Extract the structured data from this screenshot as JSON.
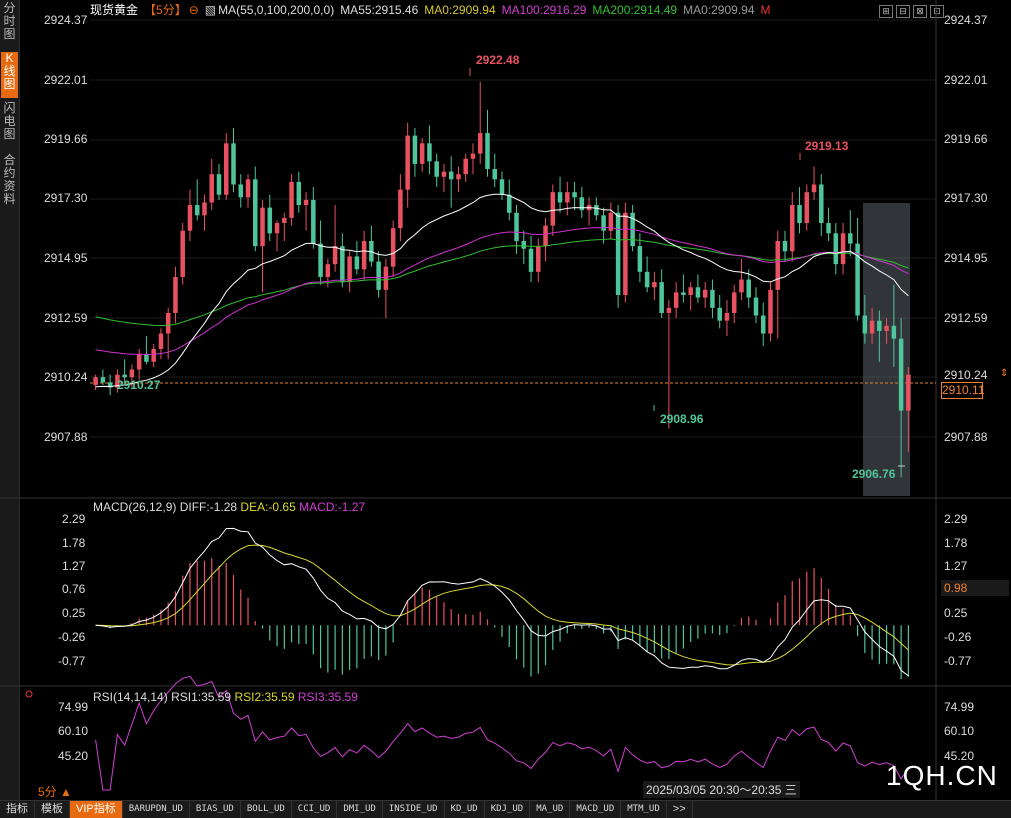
{
  "sidebar": [
    {
      "label": "分时图",
      "active": false
    },
    {
      "label": "K线图",
      "small": "K",
      "active": true
    },
    {
      "label": "闪电图",
      "active": false
    },
    {
      "label": "合约资料",
      "active": false
    }
  ],
  "header": {
    "instrument": "现货黄金",
    "period": "【5分】",
    "ma_indicator": "MA(55,0,100,200,0,0)",
    "ma55": "MA55:2915.46",
    "ma0a": "MA0:2909.94",
    "ma100": "MA100:2916.29",
    "ma200": "MA200:2914.49",
    "ma0b": "MA0:2909.94",
    "m_label": "M"
  },
  "colors": {
    "up": "#e8515f",
    "down": "#4ec59a",
    "ma55": "#ffffff",
    "ma100": "#d030d0",
    "ma200": "#30c030",
    "dea": "#d8d830",
    "accent": "#e86a10",
    "macd_label": "#d040d0"
  },
  "price_axis": [
    "2924.37",
    "2922.01",
    "2919.66",
    "2917.30",
    "2914.95",
    "2912.59",
    "2910.24",
    "2907.88"
  ],
  "current_price": "2910.11",
  "annotations": {
    "high": "2922.48",
    "right_high": "2919.13",
    "left_low": "2910.27",
    "mid_low": "2908.96",
    "low": "2906.76"
  },
  "macd": {
    "title": "MACD(26,12,9)",
    "diff": "DIFF:-1.28",
    "dea": "DEA:-0.65",
    "macd": "MACD:-1.27",
    "axis": [
      "2.29",
      "1.78",
      "1.27",
      "0.76",
      "0.25",
      "-0.26",
      "-0.77"
    ],
    "current": "0.98"
  },
  "rsi": {
    "title": "RSI(14,14,14)",
    "rsi1": "RSI1:35.59",
    "rsi2": "RSI2:35.59",
    "rsi3": "RSI3:35.59",
    "axis": [
      "74.99",
      "60.10",
      "45.20"
    ]
  },
  "period_selector": "5分 ▲",
  "time_range": "2025/03/05 20:30～20:35 三",
  "watermark": "1QH.CN",
  "bottom_tabs": [
    "指标",
    "模板",
    "VIP指标",
    "BARUPDN_UD",
    "BIAS_UD",
    "BOLL_UD",
    "CCI_UD",
    "DMI_UD",
    "INSIDE_UD",
    "KD_UD",
    "KDJ_UD",
    "MA_UD",
    "MACD_UD",
    "MTM_UD",
    ">>"
  ],
  "window_controls": [
    "⊞",
    "⊟",
    "⊠",
    "⊡"
  ],
  "chart_data": {
    "type": "candlestick",
    "ylim": [
      2906.2,
      2924.8
    ],
    "candles": [
      [
        2910.6,
        2911.0,
        2910.4,
        2910.9
      ],
      [
        2910.9,
        2911.2,
        2910.6,
        2910.7
      ],
      [
        2910.7,
        2911.0,
        2910.2,
        2910.5
      ],
      [
        2910.5,
        2911.2,
        2910.3,
        2911.0
      ],
      [
        2911.0,
        2911.6,
        2910.7,
        2910.9
      ],
      [
        2910.9,
        2911.4,
        2910.5,
        2911.2
      ],
      [
        2911.2,
        2912.0,
        2910.8,
        2911.8
      ],
      [
        2911.8,
        2912.5,
        2911.4,
        2911.5
      ],
      [
        2911.5,
        2912.2,
        2911.3,
        2912.0
      ],
      [
        2912.0,
        2912.8,
        2911.6,
        2912.6
      ],
      [
        2912.6,
        2913.6,
        2911.6,
        2913.4
      ],
      [
        2913.4,
        2915.2,
        2913.0,
        2914.8
      ],
      [
        2914.8,
        2916.9,
        2914.5,
        2916.6
      ],
      [
        2916.6,
        2918.2,
        2916.2,
        2917.6
      ],
      [
        2917.6,
        2918.6,
        2917.0,
        2917.2
      ],
      [
        2917.2,
        2918.0,
        2916.6,
        2917.7
      ],
      [
        2917.7,
        2919.4,
        2917.4,
        2918.8
      ],
      [
        2918.8,
        2919.2,
        2917.8,
        2918.0
      ],
      [
        2918.0,
        2920.4,
        2917.8,
        2920.0
      ],
      [
        2920.0,
        2920.6,
        2918.1,
        2918.4
      ],
      [
        2918.4,
        2918.8,
        2917.5,
        2917.9
      ],
      [
        2917.9,
        2918.8,
        2917.5,
        2918.6
      ],
      [
        2918.6,
        2919.1,
        2915.8,
        2916.0
      ],
      [
        2916.0,
        2917.8,
        2914.2,
        2917.5
      ],
      [
        2917.5,
        2918.0,
        2916.2,
        2916.5
      ],
      [
        2916.5,
        2917.0,
        2915.8,
        2916.9
      ],
      [
        2916.9,
        2917.3,
        2916.2,
        2917.1
      ],
      [
        2917.1,
        2918.8,
        2916.8,
        2918.5
      ],
      [
        2918.5,
        2918.9,
        2917.3,
        2917.6
      ],
      [
        2917.6,
        2918.1,
        2916.6,
        2917.8
      ],
      [
        2917.8,
        2918.3,
        2915.9,
        2916.1
      ],
      [
        2916.1,
        2917.0,
        2914.5,
        2914.8
      ],
      [
        2914.8,
        2915.5,
        2914.4,
        2915.3
      ],
      [
        2915.3,
        2917.6,
        2915.0,
        2916.0
      ],
      [
        2916.0,
        2916.5,
        2914.4,
        2914.6
      ],
      [
        2914.6,
        2915.8,
        2914.2,
        2915.6
      ],
      [
        2915.6,
        2916.2,
        2914.9,
        2915.1
      ],
      [
        2915.1,
        2916.6,
        2914.7,
        2916.2
      ],
      [
        2916.2,
        2916.8,
        2915.2,
        2915.4
      ],
      [
        2915.4,
        2915.8,
        2914.0,
        2914.3
      ],
      [
        2914.3,
        2915.5,
        2913.2,
        2915.2
      ],
      [
        2915.2,
        2917.0,
        2914.8,
        2916.7
      ],
      [
        2916.7,
        2918.8,
        2916.2,
        2918.2
      ],
      [
        2918.2,
        2920.8,
        2917.5,
        2920.3
      ],
      [
        2920.3,
        2920.6,
        2918.7,
        2919.2
      ],
      [
        2919.2,
        2920.2,
        2918.9,
        2920.0
      ],
      [
        2920.0,
        2920.7,
        2918.8,
        2919.3
      ],
      [
        2919.3,
        2919.6,
        2918.3,
        2918.7
      ],
      [
        2918.7,
        2919.2,
        2918.1,
        2918.9
      ],
      [
        2918.9,
        2919.5,
        2917.5,
        2918.6
      ],
      [
        2918.6,
        2919.1,
        2918.1,
        2918.8
      ],
      [
        2918.8,
        2919.6,
        2918.5,
        2919.4
      ],
      [
        2919.4,
        2920.0,
        2918.8,
        2919.6
      ],
      [
        2919.6,
        2922.4,
        2919.2,
        2920.4
      ],
      [
        2920.4,
        2921.3,
        2918.7,
        2919.0
      ],
      [
        2919.0,
        2919.6,
        2918.3,
        2918.6
      ],
      [
        2918.6,
        2918.9,
        2917.8,
        2918.0
      ],
      [
        2918.0,
        2918.6,
        2917.0,
        2917.3
      ],
      [
        2917.3,
        2917.6,
        2915.7,
        2916.2
      ],
      [
        2916.2,
        2916.6,
        2915.3,
        2915.9
      ],
      [
        2915.9,
        2916.4,
        2914.6,
        2915.0
      ],
      [
        2915.0,
        2916.3,
        2914.6,
        2916.0
      ],
      [
        2916.0,
        2917.1,
        2915.4,
        2916.8
      ],
      [
        2916.8,
        2918.4,
        2916.4,
        2918.1
      ],
      [
        2918.1,
        2918.7,
        2917.3,
        2917.7
      ],
      [
        2917.7,
        2918.5,
        2917.2,
        2918.1
      ],
      [
        2918.1,
        2918.5,
        2917.4,
        2917.9
      ],
      [
        2917.9,
        2918.3,
        2917.1,
        2917.4
      ],
      [
        2917.4,
        2917.9,
        2916.8,
        2917.6
      ],
      [
        2917.6,
        2917.9,
        2917.0,
        2917.2
      ],
      [
        2917.2,
        2917.5,
        2916.1,
        2916.6
      ],
      [
        2916.6,
        2917.7,
        2916.3,
        2917.3
      ],
      [
        2917.3,
        2917.6,
        2913.6,
        2914.1
      ],
      [
        2914.1,
        2917.7,
        2913.8,
        2917.3
      ],
      [
        2917.3,
        2917.6,
        2915.8,
        2916.0
      ],
      [
        2916.0,
        2916.5,
        2914.6,
        2915.0
      ],
      [
        2915.0,
        2915.6,
        2914.2,
        2914.4
      ],
      [
        2914.4,
        2915.0,
        2913.9,
        2914.6
      ],
      [
        2914.6,
        2915.1,
        2913.2,
        2913.4
      ],
      [
        2913.4,
        2913.9,
        2908.9,
        2913.6
      ],
      [
        2913.6,
        2914.6,
        2913.2,
        2914.2
      ],
      [
        2914.2,
        2914.9,
        2913.8,
        2914.1
      ],
      [
        2914.1,
        2914.6,
        2913.5,
        2914.4
      ],
      [
        2914.4,
        2914.9,
        2913.8,
        2914.0
      ],
      [
        2914.0,
        2914.6,
        2913.6,
        2914.3
      ],
      [
        2914.3,
        2914.7,
        2913.2,
        2913.6
      ],
      [
        2913.6,
        2914.1,
        2912.8,
        2913.1
      ],
      [
        2913.1,
        2913.9,
        2912.5,
        2913.4
      ],
      [
        2913.4,
        2914.5,
        2913.0,
        2914.2
      ],
      [
        2914.2,
        2915.5,
        2913.9,
        2914.7
      ],
      [
        2914.7,
        2915.1,
        2913.6,
        2914.0
      ],
      [
        2914.0,
        2914.4,
        2913.0,
        2913.3
      ],
      [
        2913.3,
        2913.8,
        2912.1,
        2912.6
      ],
      [
        2912.6,
        2914.6,
        2912.3,
        2914.3
      ],
      [
        2914.3,
        2916.6,
        2912.4,
        2916.2
      ],
      [
        2916.2,
        2916.6,
        2915.4,
        2915.8
      ],
      [
        2915.8,
        2918.1,
        2915.4,
        2917.6
      ],
      [
        2917.6,
        2918.3,
        2916.5,
        2916.9
      ],
      [
        2916.9,
        2918.4,
        2916.6,
        2918.1
      ],
      [
        2918.1,
        2919.1,
        2917.8,
        2918.4
      ],
      [
        2918.4,
        2918.8,
        2916.4,
        2916.9
      ],
      [
        2916.9,
        2917.5,
        2916.2,
        2916.5
      ],
      [
        2916.5,
        2916.9,
        2914.9,
        2915.3
      ],
      [
        2915.3,
        2916.9,
        2914.9,
        2916.5
      ],
      [
        2916.5,
        2917.4,
        2915.6,
        2916.1
      ],
      [
        2916.1,
        2917.1,
        2913.1,
        2913.3
      ],
      [
        2913.3,
        2914.1,
        2912.2,
        2912.6
      ],
      [
        2912.6,
        2913.6,
        2912.2,
        2913.1
      ],
      [
        2913.1,
        2913.5,
        2911.5,
        2912.7
      ],
      [
        2912.7,
        2913.2,
        2912.2,
        2912.9
      ],
      [
        2912.9,
        2914.5,
        2911.3,
        2912.4
      ],
      [
        2912.4,
        2913.2,
        2907.0,
        2909.6
      ],
      [
        2909.6,
        2911.3,
        2908.0,
        2911.0
      ]
    ]
  }
}
